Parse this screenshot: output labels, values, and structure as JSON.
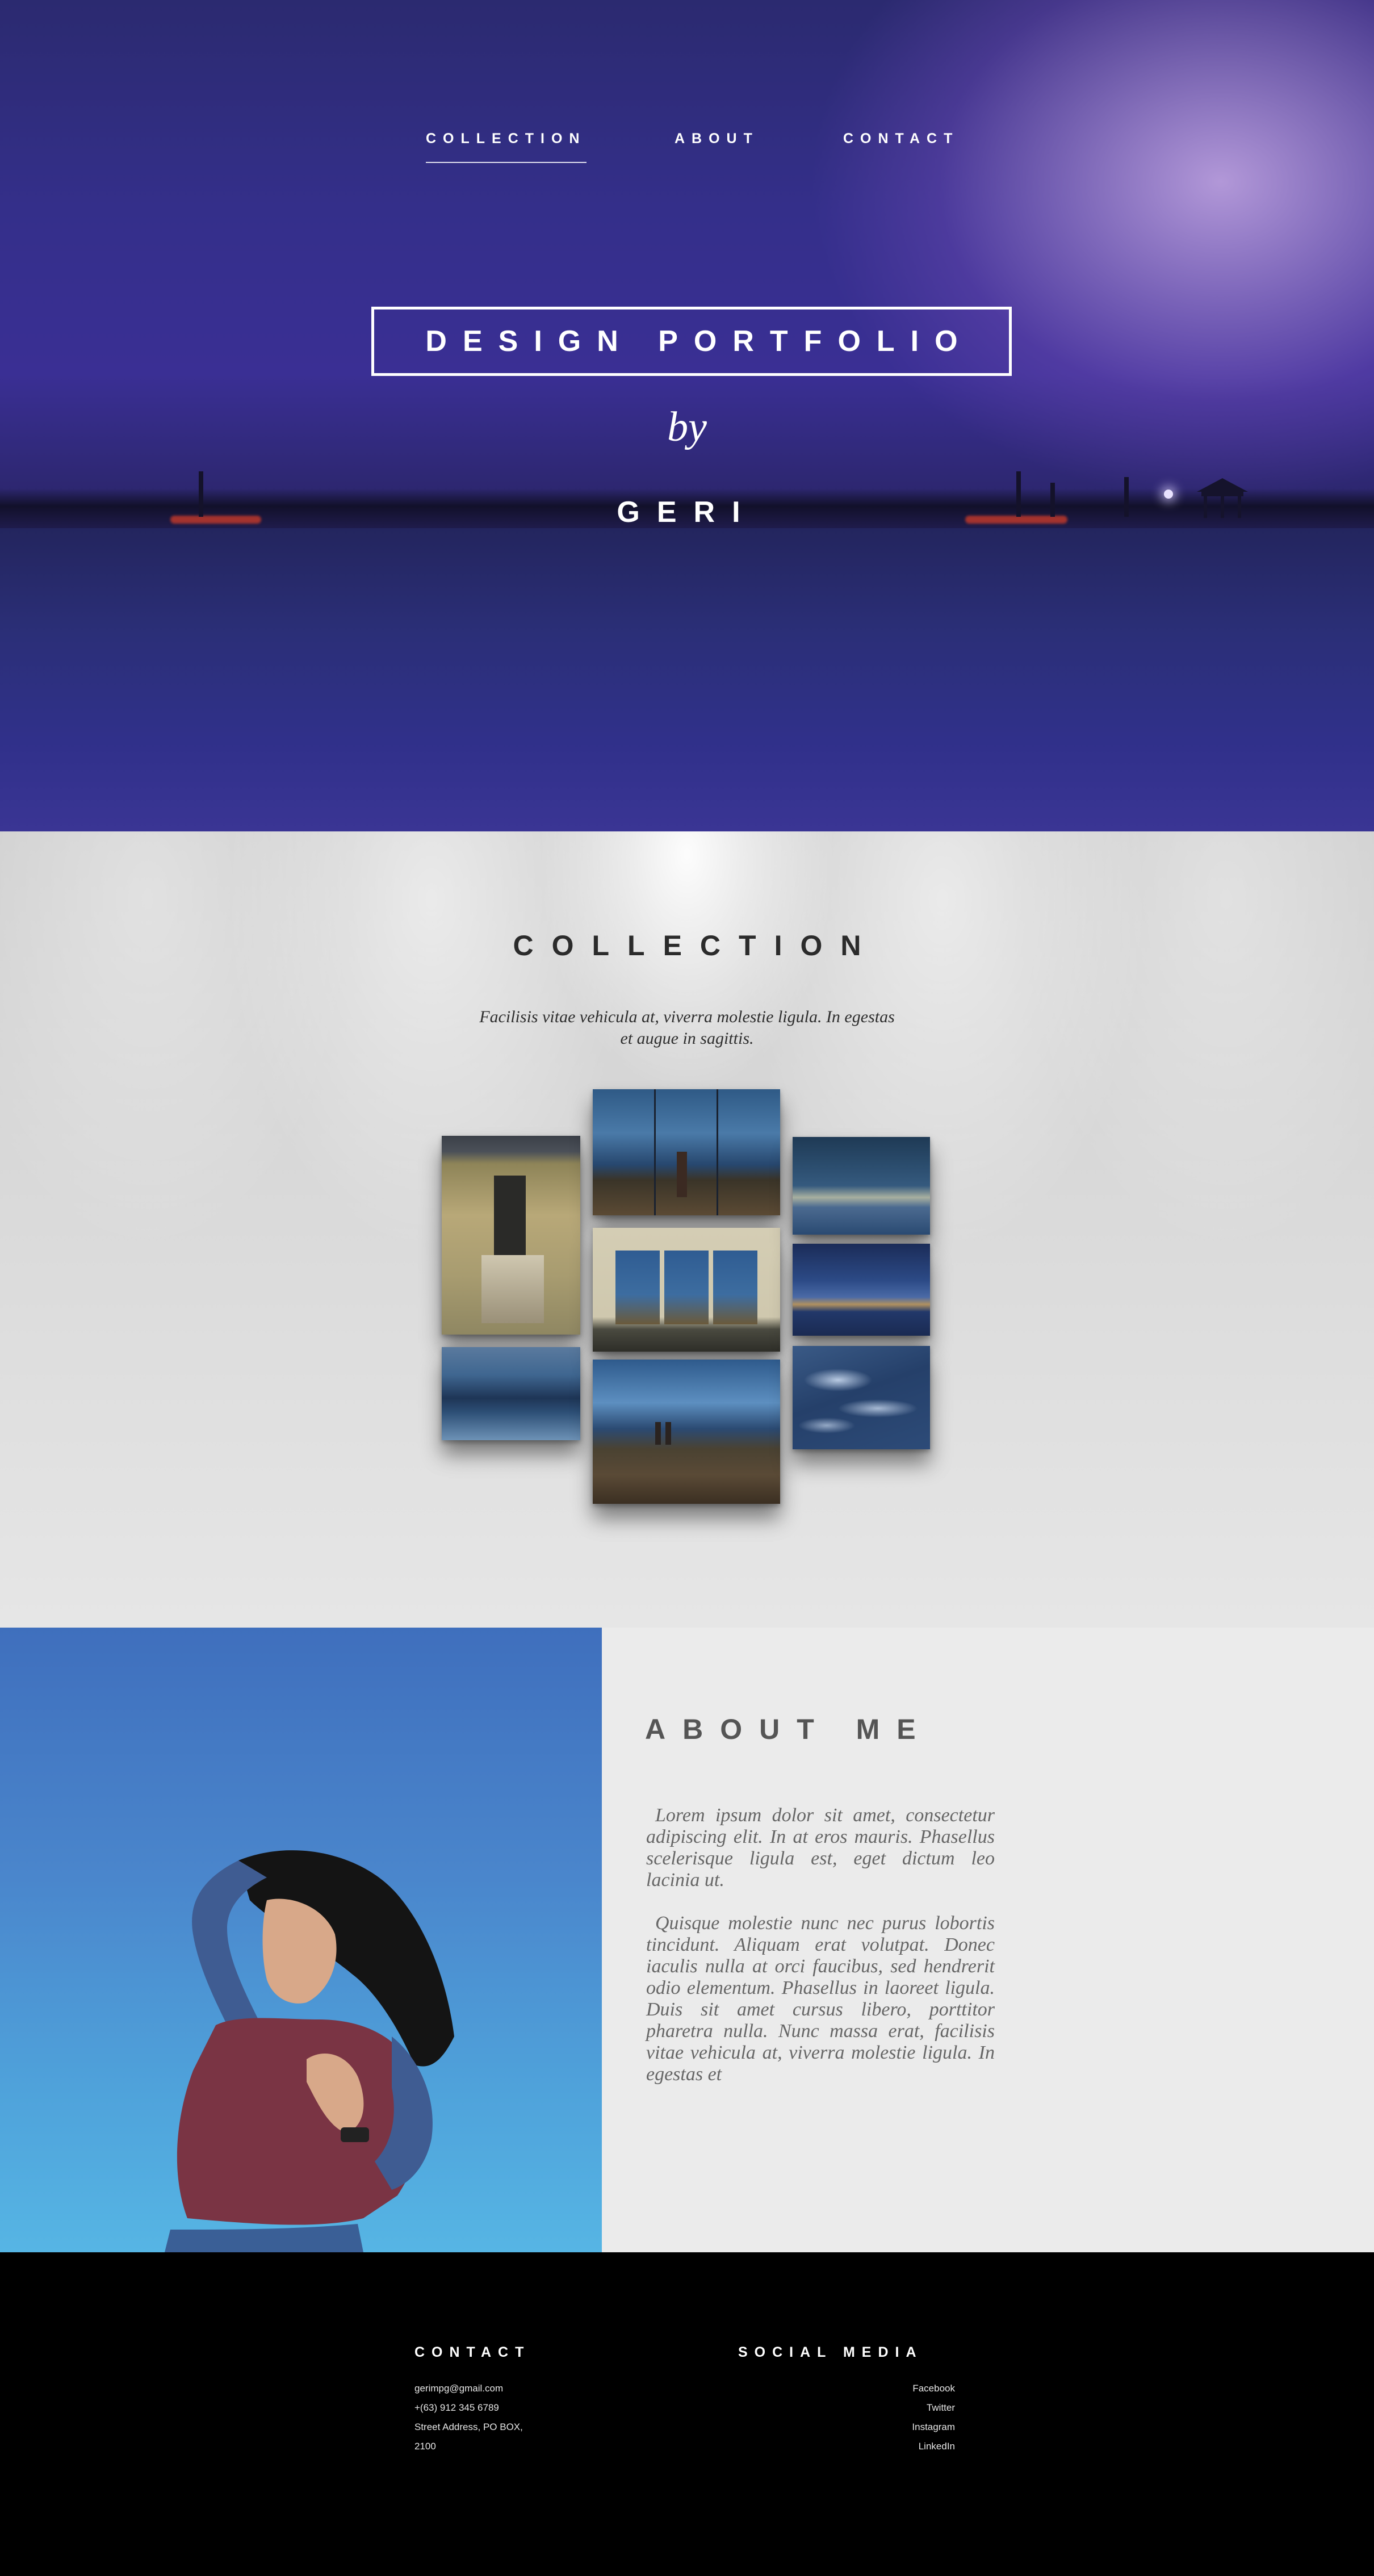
{
  "nav": {
    "items": [
      {
        "label": "COLLECTION"
      },
      {
        "label": "ABOUT"
      },
      {
        "label": "CONTACT"
      }
    ]
  },
  "hero": {
    "title": "DESIGN PORTFOLIO",
    "by": "by",
    "author": "GERI"
  },
  "collection": {
    "title": "COLLECTION",
    "description": "Facilisis vitae vehicula at, viverra molestie ligula. In egestas et augue in sagittis."
  },
  "about": {
    "title": "ABOUT ME",
    "paragraph_1": "Lorem ipsum dolor sit amet, consectetur adipiscing elit. In at eros mauris. Phasellus scelerisque ligula est, eget dictum leo lacinia ut.",
    "paragraph_2": "Quisque molestie nunc nec purus lobortis tincidunt. Aliquam erat volutpat. Donec iaculis nulla at orci faucibus, sed hendrerit odio elementum. Phasellus in laoreet ligula. Duis sit amet cursus libero, porttitor pharetra nulla. Nunc massa erat, facilisis vitae vehicula at, viverra molestie ligula. In egestas et"
  },
  "footer": {
    "contact": {
      "heading": "CONTACT",
      "email": "gerimpg@gmail.com",
      "phone": "+(63) 912 345 6789",
      "address_line_1": "Street Address, PO BOX,",
      "address_line_2": "2100"
    },
    "social": {
      "heading": "SOCIAL MEDIA",
      "links": [
        "Facebook",
        "Twitter",
        "Instagram",
        "LinkedIn"
      ]
    }
  },
  "colors": {
    "hero_sky": "#342f8a",
    "collection_bg": "#d8d8d8",
    "about_bg": "#ebebeb",
    "footer_bg": "#000000",
    "heading_dark": "#2b2b2b"
  }
}
